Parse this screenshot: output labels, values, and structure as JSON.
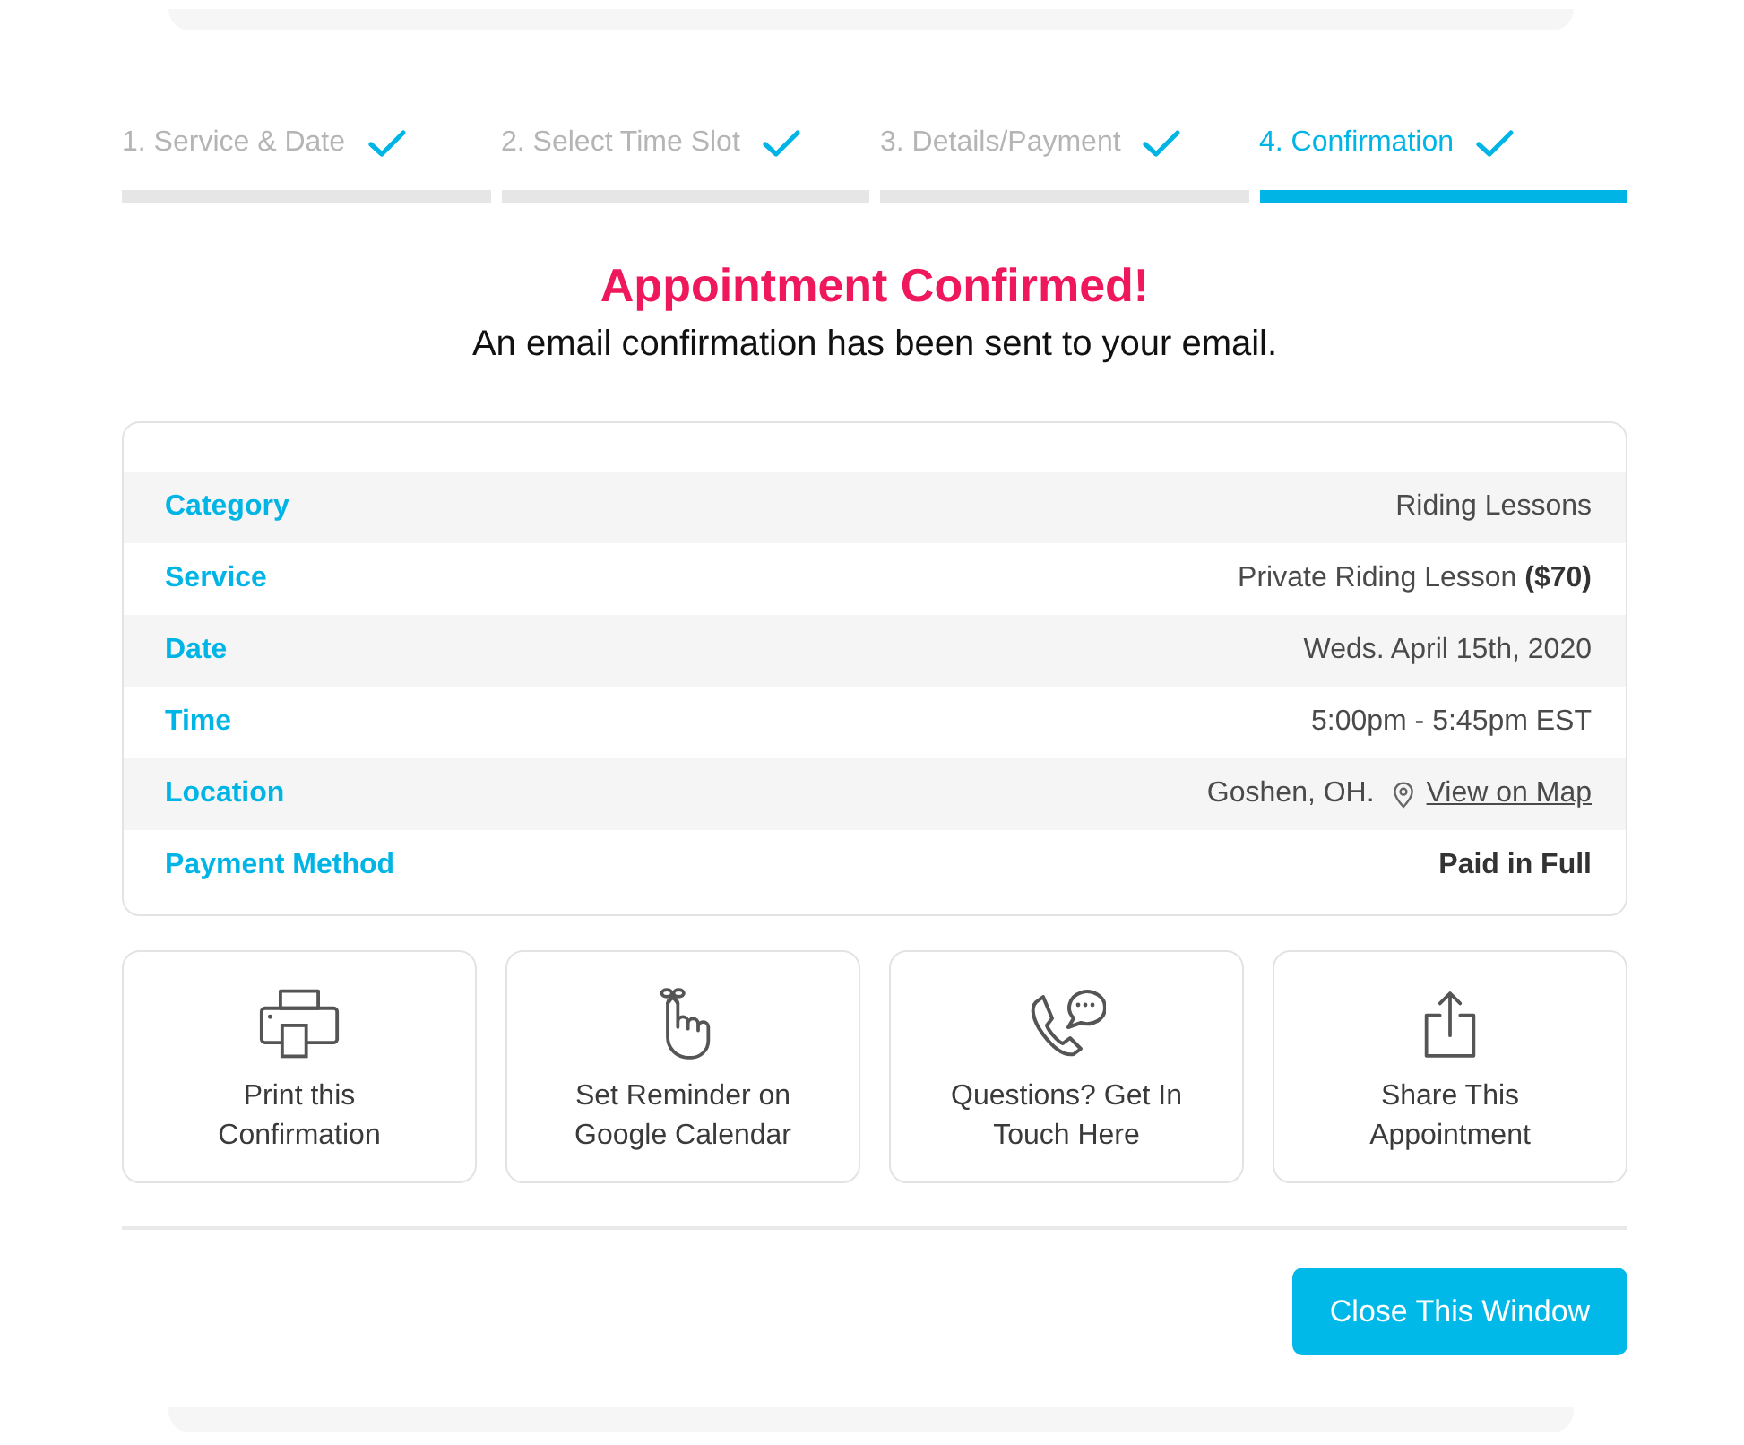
{
  "steps": [
    {
      "label": "1. Service & Date",
      "completed": true,
      "selected": false
    },
    {
      "label": "2. Select Time Slot",
      "completed": true,
      "selected": false
    },
    {
      "label": "3. Details/Payment",
      "completed": true,
      "selected": false
    },
    {
      "label": "4. Confirmation",
      "completed": true,
      "selected": true
    }
  ],
  "heading": {
    "title": "Appointment Confirmed!",
    "subtitle": "An email confirmation has been sent to your email."
  },
  "details": [
    {
      "kind": "plain",
      "label": "Category",
      "value": "Riding Lessons"
    },
    {
      "kind": "plain",
      "label": "Service",
      "value": "Private Riding Lesson **($70)**"
    },
    {
      "kind": "plain",
      "label": "Date",
      "value": "Weds. April 15th, 2020"
    },
    {
      "kind": "plain",
      "label": "Time",
      "value": "5:00pm - 5:45pm EST"
    },
    {
      "kind": "location",
      "label": "Location",
      "value": "Goshen, OH.",
      "link": "View on Map"
    },
    {
      "kind": "strong",
      "label": "Payment Method",
      "value": "Paid in Full"
    }
  ],
  "actions": [
    {
      "kind": "print",
      "label": "Print this Confirmation"
    },
    {
      "kind": "reminder",
      "label": "Set Reminder on Google Calendar"
    },
    {
      "kind": "contact",
      "label": "Questions? Get In Touch Here"
    },
    {
      "kind": "share",
      "label": "Share This Appointment"
    }
  ],
  "footer": {
    "button": "Close This Window"
  }
}
